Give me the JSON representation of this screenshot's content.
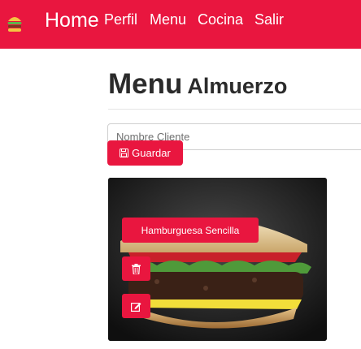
{
  "navbar": {
    "brand_icon": "burger-icon",
    "home": "Home",
    "links": [
      "Perfil",
      "Menu",
      "Cocina",
      "Salir"
    ]
  },
  "page": {
    "title": "Menu",
    "subtitle": "Almuerzo"
  },
  "form": {
    "name_placeholder": "Nombre Cliente",
    "save_label": "Guardar",
    "save_icon": "save-icon"
  },
  "item": {
    "name": "Hamburguesa Sencilla",
    "delete_icon": "trash-icon",
    "edit_icon": "edit-icon"
  },
  "colors": {
    "brand": "#e9163f"
  }
}
